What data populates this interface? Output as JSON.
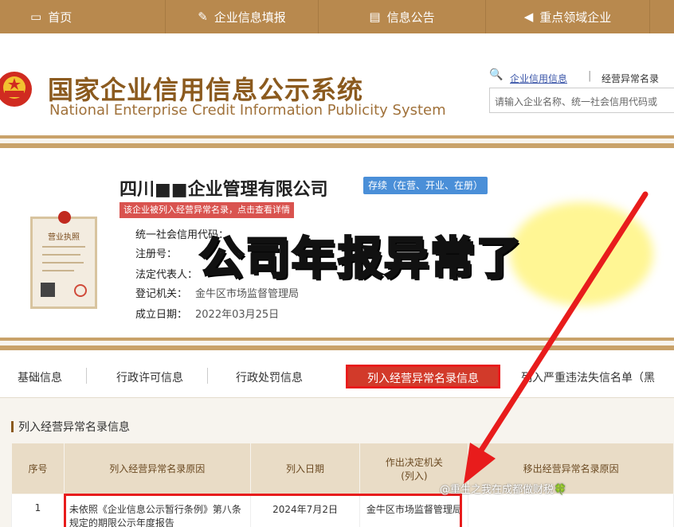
{
  "nav": [
    {
      "label": "首页",
      "icon": "monitor-icon"
    },
    {
      "label": "企业信息填报",
      "icon": "edit-icon"
    },
    {
      "label": "信息公告",
      "icon": "document-icon"
    },
    {
      "label": "重点领域企业",
      "icon": "megaphone-icon"
    }
  ],
  "header": {
    "title_cn": "国家企业信用信息公示系统",
    "title_en": "National Enterprise Credit Information Publicity System",
    "link_credit": "企业信用信息",
    "link_abnormal": "经营异常名录",
    "search_placeholder": "请输入企业名称、统一社会信用代码或"
  },
  "company": {
    "name": "四川■■企业管理有限公司",
    "status": "存续（在营、开业、在册）",
    "alert": "该企业被列入经营异常名录，点击查看详情",
    "license_label": "营业执照",
    "fields": [
      {
        "label": "统一社会信用代码：",
        "value": ""
      },
      {
        "label": "注册号：",
        "value": ""
      },
      {
        "label": "法定代表人：",
        "value": ""
      },
      {
        "label": "登记机关：",
        "value": "金牛区市场监督管理局"
      },
      {
        "label": "成立日期：",
        "value": "2022年03月25日"
      }
    ]
  },
  "overlay_text": "公司年报异常了",
  "tabs": [
    "基础信息",
    "行政许可信息",
    "行政处罚信息",
    "列入经营异常名录信息",
    "列入严重违法失信名单（黑"
  ],
  "section_title": "列入经营异常名录信息",
  "table": {
    "headers": [
      "序号",
      "列入经营异常名录原因",
      "列入日期",
      "作出决定机关\n(列入)",
      "移出经营异常名录原因"
    ],
    "rows": [
      {
        "no": "1",
        "reason": "未依照《企业信息公示暂行条例》第八条规定的期限公示年度报告",
        "date": "2024年7月2日",
        "authority": "金牛区市场监督管理局",
        "remove_reason": ""
      }
    ]
  },
  "watermark": "@重生之我在成都做财税🍀",
  "colors": {
    "nav_bg": "#b8894e",
    "brand_brown": "#8b5a1e",
    "alert_red": "#d9534f",
    "highlight_red": "#e81c1c",
    "status_blue": "#4a8fd8"
  }
}
